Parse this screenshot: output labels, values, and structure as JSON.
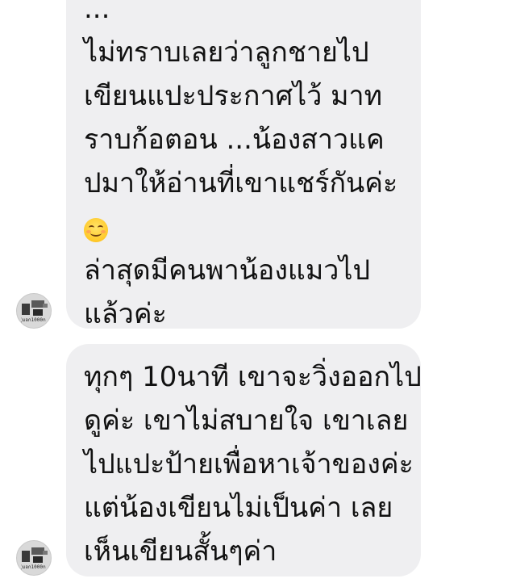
{
  "messages": [
    {
      "sender": "incoming",
      "lines": [
        "...",
        "ไม่ทราบเลยว่าลูกชายไป",
        "เขียนแปะประกาศไว้ มาท",
        "ราบก้อตอน ...น้องสาวแค",
        "ปมาให้อ่านที่เขาแชร์กันค่ะ",
        "",
        "ล่าสุดมีคนพาน้องแมวไป",
        "แล้วค่ะ"
      ],
      "emoji": "smiling-face-emoji",
      "avatar_caption": "ุ่มอก1000ก"
    },
    {
      "sender": "incoming",
      "lines": [
        "ทุกๆ 10นาที เขาจะวิ่งออกไป",
        "ดูค่ะ เขาไม่สบายใจ เขาเลย",
        "ไปแปะป้ายเพื่อหาเจ้าของค่ะ",
        "แต่น้องเขียนไม่เป็นค่า เลย",
        "เห็นเขียนสั้นๆค่า"
      ],
      "avatar_caption": "ุ่มอก1000ก"
    }
  ],
  "colors": {
    "bubble_bg": "#efeff1",
    "text": "#111111",
    "background": "#ffffff"
  }
}
